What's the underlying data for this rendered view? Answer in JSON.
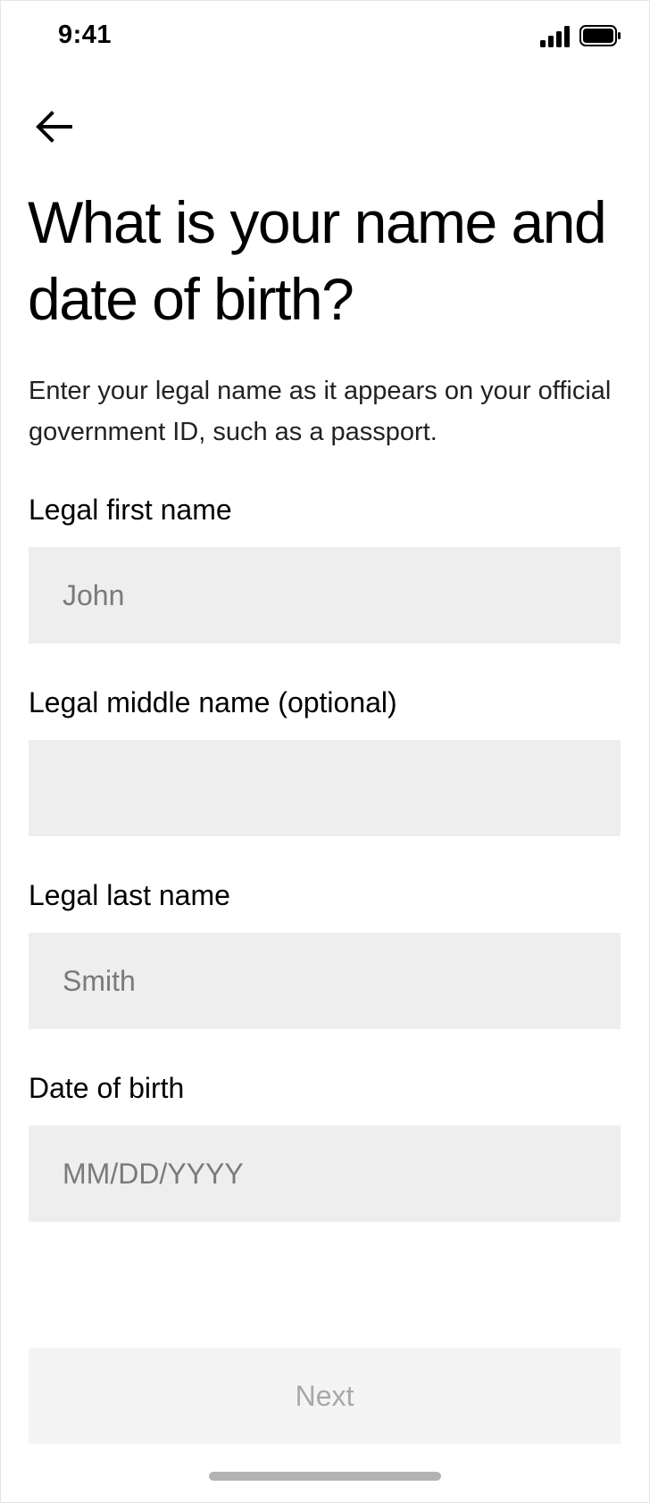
{
  "status_bar": {
    "time": "9:41"
  },
  "icons": {
    "signal": "cellular-signal-icon",
    "battery": "battery-icon",
    "back": "arrow-left-icon"
  },
  "page": {
    "title": "What is your name and date of birth?",
    "subtitle": "Enter your legal name as it appears on your official government ID, such as a passport."
  },
  "form": {
    "first_name": {
      "label": "Legal first name",
      "placeholder": "John",
      "value": ""
    },
    "middle_name": {
      "label": "Legal middle name (optional)",
      "placeholder": "",
      "value": ""
    },
    "last_name": {
      "label": "Legal last name",
      "placeholder": "Smith",
      "value": ""
    },
    "date_of_birth": {
      "label": "Date of birth",
      "placeholder": "MM/DD/YYYY",
      "value": ""
    }
  },
  "actions": {
    "next_label": "Next",
    "next_enabled": false
  },
  "colors": {
    "input_background": "#eeeeee",
    "button_disabled_background": "#f4f4f4",
    "button_disabled_text": "#a8a8a8",
    "placeholder_text": "#7a7a7a"
  }
}
